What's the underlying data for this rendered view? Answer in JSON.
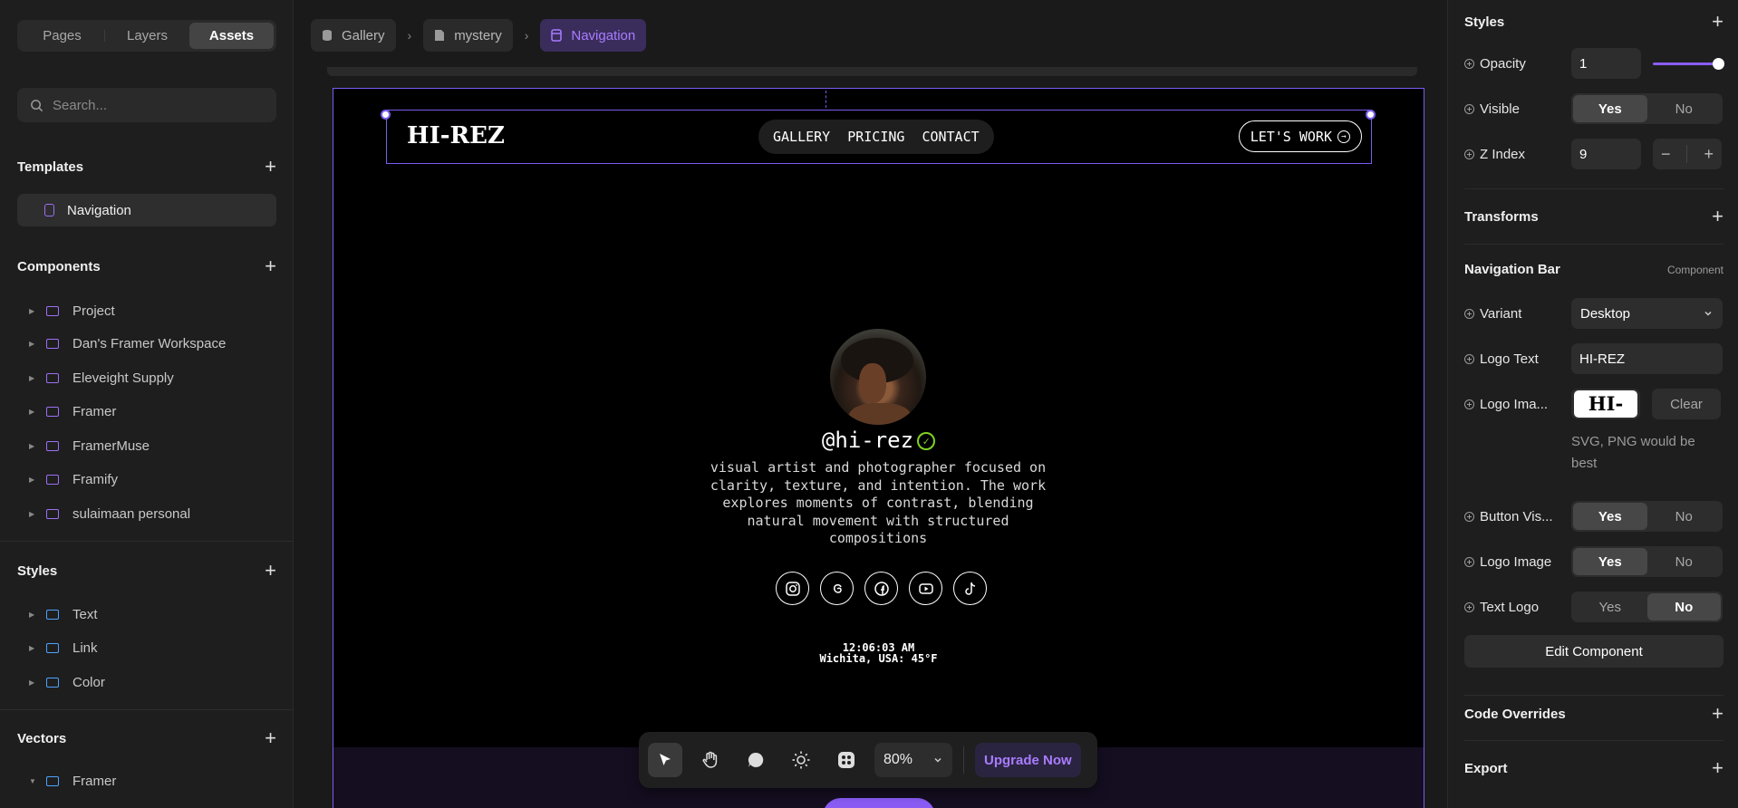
{
  "left": {
    "tabs": [
      "Pages",
      "Layers",
      "Assets"
    ],
    "active_tab": "Assets",
    "search_placeholder": "Search...",
    "templates": {
      "title": "Templates",
      "items": [
        "Navigation"
      ]
    },
    "components": {
      "title": "Components",
      "items": [
        "Project",
        "Dan's Framer Workspace",
        "Eleveight Supply",
        "Framer",
        "FramerMuse",
        "Framify",
        "sulaimaan personal"
      ]
    },
    "styles": {
      "title": "Styles",
      "items": [
        "Text",
        "Link",
        "Color"
      ]
    },
    "vectors": {
      "title": "Vectors",
      "items": [
        "Framer"
      ]
    }
  },
  "breadcrumb": [
    "Gallery",
    "mystery",
    "Navigation"
  ],
  "site": {
    "logo": "HI-REZ",
    "nav": [
      "GALLERY",
      "PRICING",
      "CONTACT"
    ],
    "cta": "LET'S WORK",
    "handle": "@hi-rez",
    "bio": "visual artist and photographer focused on clarity, texture, and intention. The work explores moments of contrast, blending natural movement with structured compositions",
    "socials": [
      "instagram-icon",
      "threads-icon",
      "facebook-icon",
      "youtube-icon",
      "tiktok-icon"
    ],
    "time": "12:06:03 AM",
    "location": "Wichita, USA: 45°F"
  },
  "toolbar": {
    "zoom": "80%",
    "upgrade": "Upgrade Now"
  },
  "right": {
    "styles": {
      "title": "Styles",
      "opacity_label": "Opacity",
      "opacity_value": "1",
      "opacity_level": 1.0,
      "visible_label": "Visible",
      "visible_options": [
        "Yes",
        "No"
      ],
      "visible_selected": "Yes",
      "zindex_label": "Z Index",
      "zindex_value": "9"
    },
    "transforms_title": "Transforms",
    "component": {
      "title": "Navigation Bar",
      "tag": "Component",
      "variant_label": "Variant",
      "variant_value": "Desktop",
      "logo_text_label": "Logo Text",
      "logo_text_value": "HI-REZ",
      "logo_image_label": "Logo Ima...",
      "logo_image_preview": "HI-REZ",
      "clear_label": "Clear",
      "hint": "SVG, PNG would be best",
      "button_vis_label": "Button Vis...",
      "button_vis_options": [
        "Yes",
        "No"
      ],
      "button_vis_selected": "Yes",
      "logo_image2_label": "Logo Image",
      "logo_image2_options": [
        "Yes",
        "No"
      ],
      "logo_image2_selected": "Yes",
      "text_logo_label": "Text Logo",
      "text_logo_options": [
        "Yes",
        "No"
      ],
      "text_logo_selected": "No",
      "edit_label": "Edit Component"
    },
    "code_overrides_title": "Code Overrides",
    "export_title": "Export"
  }
}
